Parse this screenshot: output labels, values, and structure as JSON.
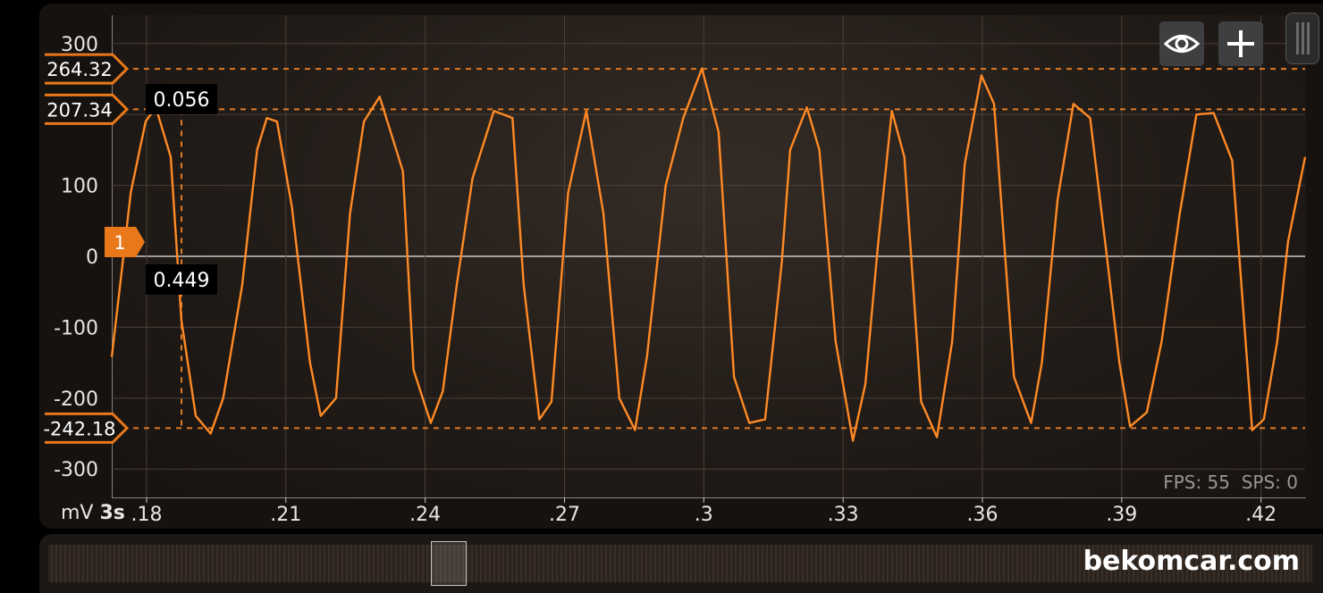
{
  "chart_data": {
    "type": "line",
    "y_unit": "mV",
    "time_base": "3s",
    "ylim": [
      -340,
      340
    ],
    "xlim": [
      0.1725,
      0.4295
    ],
    "y_ticks": [
      "300",
      "100",
      "0",
      "-100",
      "-200",
      "-300"
    ],
    "x_ticks": [
      ".18",
      ".21",
      ".24",
      ".27",
      ".3",
      ".33",
      ".36",
      ".39",
      ".42"
    ],
    "grid": true,
    "series": [
      {
        "x": [
          0.1725,
          0.1743,
          0.1766,
          0.1798,
          0.182,
          0.1852,
          0.1875,
          0.1906,
          0.1938,
          0.1965,
          0.2006,
          0.2038,
          0.2059,
          0.2081,
          0.2113,
          0.2152,
          0.2175,
          0.2208,
          0.2238,
          0.2268,
          0.2302,
          0.2352,
          0.2375,
          0.2412,
          0.2438,
          0.2468,
          0.2502,
          0.2548,
          0.2588,
          0.2612,
          0.2646,
          0.2672,
          0.2708,
          0.2747,
          0.2784,
          0.2818,
          0.2852,
          0.2878,
          0.2918,
          0.2956,
          0.2996,
          0.3032,
          0.3065,
          0.3098,
          0.3132,
          0.3168,
          0.3186,
          0.3222,
          0.3249,
          0.3284,
          0.3321,
          0.3348,
          0.3375,
          0.3405,
          0.3432,
          0.3468,
          0.3502,
          0.3535,
          0.3562,
          0.3598,
          0.3625,
          0.3668,
          0.3705,
          0.3728,
          0.3762,
          0.3796,
          0.3832,
          0.3868,
          0.3895,
          0.3918,
          0.3954,
          0.3986,
          0.4025,
          0.4061,
          0.4098,
          0.4138,
          0.4181,
          0.4206,
          0.4235,
          0.4258,
          0.4295
        ],
        "y": [
          -142,
          -40,
          90,
          190,
          210,
          140,
          -90,
          -225,
          -250,
          -200,
          -40,
          150,
          195,
          190,
          70,
          -150,
          -225,
          -200,
          60,
          190,
          225,
          120,
          -160,
          -235,
          -190,
          -40,
          110,
          205,
          195,
          -40,
          -230,
          -205,
          90,
          205,
          60,
          -200,
          -245,
          -140,
          100,
          195,
          265,
          175,
          -170,
          -235,
          -230,
          -8,
          150,
          210,
          150,
          -120,
          -260,
          -180,
          15,
          205,
          140,
          -205,
          -255,
          -120,
          130,
          255,
          215,
          -170,
          -235,
          -150,
          80,
          215,
          195,
          0,
          -150,
          -240,
          -220,
          -120,
          60,
          200,
          202,
          135,
          -245,
          -230,
          -120,
          20,
          140
        ]
      }
    ],
    "cursor_levels": [
      "264.32",
      "207.34",
      "-242.18"
    ],
    "cursor_readout_x": "0.056",
    "cursor_readout_y": "0.449",
    "channel_label": "1"
  },
  "status": {
    "fps": "FPS: 55",
    "sps": "SPS: 0"
  },
  "toolbar": {
    "eye_icon": "eye-icon",
    "plus_icon": "plus-icon"
  },
  "watermark": "bekomcar.com",
  "colors": {
    "trace": "#ff8a25",
    "cursor": "#e07a25",
    "tag": "#e8781a"
  }
}
